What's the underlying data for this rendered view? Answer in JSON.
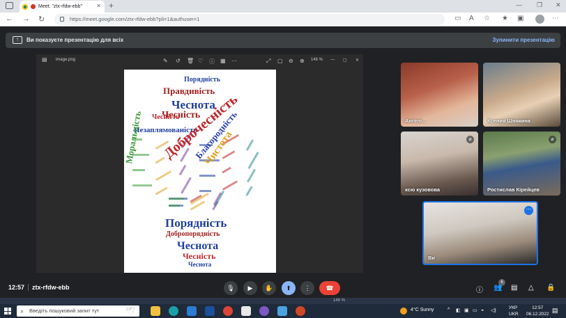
{
  "browser": {
    "tab_title": "Meet: \"ztx-rfdw-ebb\"",
    "tab_close": "✕",
    "new_tab": "+",
    "url": "https://meet.google.com/ztx-rfdw-ebb?pli=1&authuser=1"
  },
  "presentation_banner": {
    "text": "Ви показуєте презентацію для всіх",
    "stop_label": "Зупинити презентацію"
  },
  "viewer": {
    "filename": "image.png",
    "zoom": "146 %"
  },
  "word_cloud": {
    "words": [
      {
        "t": "Порядність",
        "c": "#1f3fa0"
      },
      {
        "t": "Правдивість",
        "c": "#a01f1f"
      },
      {
        "t": "Чесність",
        "c": "#a01f1f"
      },
      {
        "t": "Чеснота",
        "c": "#1f3fa0"
      },
      {
        "t": "Незаплямованість",
        "c": "#1f3fa0"
      },
      {
        "t": "Моральність",
        "c": "#3a9a3a"
      },
      {
        "t": "Доброчесність",
        "c": "#c0262a"
      },
      {
        "t": "Чистота",
        "c": "#e0a020"
      },
      {
        "t": "Благородність",
        "c": "#2a40b0"
      },
      {
        "t": "Чесність",
        "c": "#c0262a"
      },
      {
        "t": "Порядність",
        "c": "#1f3fa0"
      },
      {
        "t": "Добропорядність",
        "c": "#a01f1f"
      },
      {
        "t": "Чеснота",
        "c": "#1f3fa0"
      },
      {
        "t": "Чесність",
        "c": "#c0262a"
      },
      {
        "t": "Чеснота",
        "c": "#1f3fa0"
      }
    ]
  },
  "participants": [
    {
      "name": "Ангелі...",
      "muted": false
    },
    {
      "name": "Ксения Шнякина",
      "muted": false
    },
    {
      "name": "ксю кузовова",
      "muted": true
    },
    {
      "name": "Ростислав Кірейцев",
      "muted": true
    },
    {
      "name": "Ви",
      "muted": false
    }
  ],
  "bottom_bar": {
    "time": "12:57",
    "meeting_code": "ztx-rfdw-ebb",
    "people_count": "6"
  },
  "taskbar": {
    "search_placeholder": "Введіть пошуковий запит тут",
    "weather": "4°C  Sunny",
    "lang_top": "УКР",
    "lang_bottom": "UKR",
    "time": "12:57",
    "date": "06.12.2022",
    "ghost_zoom": "146 %"
  },
  "colors": {
    "meet_bg": "#202124",
    "end_call": "#ea4335",
    "present_active": "#8ab4f8",
    "self_border": "#1a73e8"
  }
}
